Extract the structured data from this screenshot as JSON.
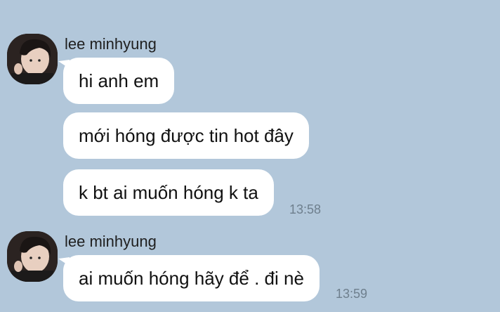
{
  "chat": {
    "groups": [
      {
        "sender": "lee minhyung",
        "messages": [
          "hi anh em",
          "mới hóng được tin hot đây",
          "k bt ai muốn hóng k ta"
        ],
        "time": "13:58"
      },
      {
        "sender": "lee minhyung",
        "messages": [
          "ai muốn hóng hãy để . đi nè"
        ],
        "time": "13:59"
      }
    ]
  },
  "colors": {
    "background": "#b2c7da",
    "bubble": "#ffffff",
    "timestamp": "#6e7f8d"
  },
  "icons": {
    "avatar": "profile-photo-avatar"
  }
}
